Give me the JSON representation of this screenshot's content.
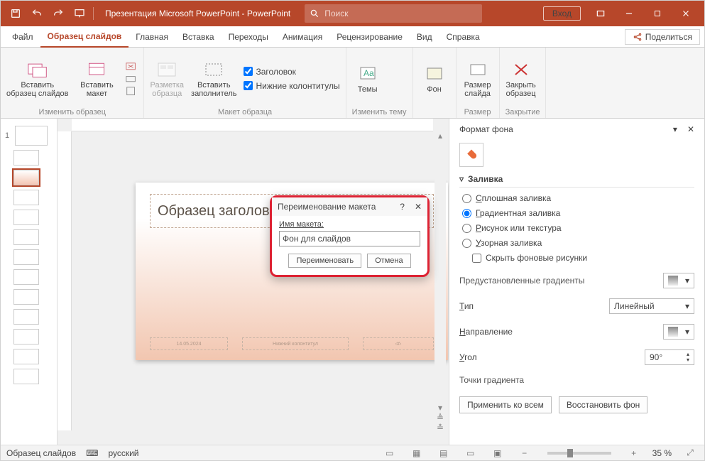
{
  "titlebar": {
    "title": "Презентация Microsoft PowerPoint - PowerPoint",
    "search_placeholder": "Поиск",
    "login": "Вход"
  },
  "tabs": {
    "file": "Файл",
    "slide_master": "Образец слайдов",
    "home": "Главная",
    "insert": "Вставка",
    "transitions": "Переходы",
    "animations": "Анимация",
    "review": "Рецензирование",
    "view": "Вид",
    "help": "Справка",
    "share": "Поделиться"
  },
  "ribbon": {
    "insert_master": "Вставить\nобразец слайдов",
    "insert_layout": "Вставить\nмакет",
    "master_layout": "Разметка\nобразца",
    "insert_placeholder": "Вставить\nзаполнитель",
    "chk_title": "Заголовок",
    "chk_footers": "Нижние колонтитулы",
    "themes": "Темы",
    "background": "Фон",
    "slide_size": "Размер\nслайда",
    "close": "Закрыть\nобразец",
    "g_edit": "Изменить образец",
    "g_layout": "Макет образца",
    "g_theme": "Изменить тему",
    "g_size": "Размер",
    "g_close": "Закрытие"
  },
  "slide": {
    "title_placeholder": "Образец заголовка",
    "footer_date": "14.05.2024",
    "footer_mid": "Нижний колонтитул",
    "footer_num": "‹#›"
  },
  "thumbs": {
    "num1": "1"
  },
  "pane": {
    "title": "Формат фона",
    "section": "Заливка",
    "r_solid": "плошная заливка",
    "r_gradient": "радиентная заливка",
    "r_picture": "исунок или текстура",
    "r_pattern": "зорная заливка",
    "chk_hide": "Скрыть фоновые рисунки",
    "preset": "Предустановленные градиенты",
    "type_lbl": "ип",
    "type_val": "Линейный",
    "direction": "аправление",
    "angle_lbl": "гол",
    "angle_val": "90°",
    "stops": "Точки градиента",
    "apply_all": "Применить ко всем",
    "reset": "Восстановить фон"
  },
  "modal": {
    "title": "Переименование макета",
    "field_label": "Имя макета:",
    "field_value": "Фон для слайдов",
    "rename": "Переименовать",
    "cancel": "Отмена"
  },
  "status": {
    "mode": "Образец слайдов",
    "lang": "русский",
    "zoom": "35 %"
  }
}
